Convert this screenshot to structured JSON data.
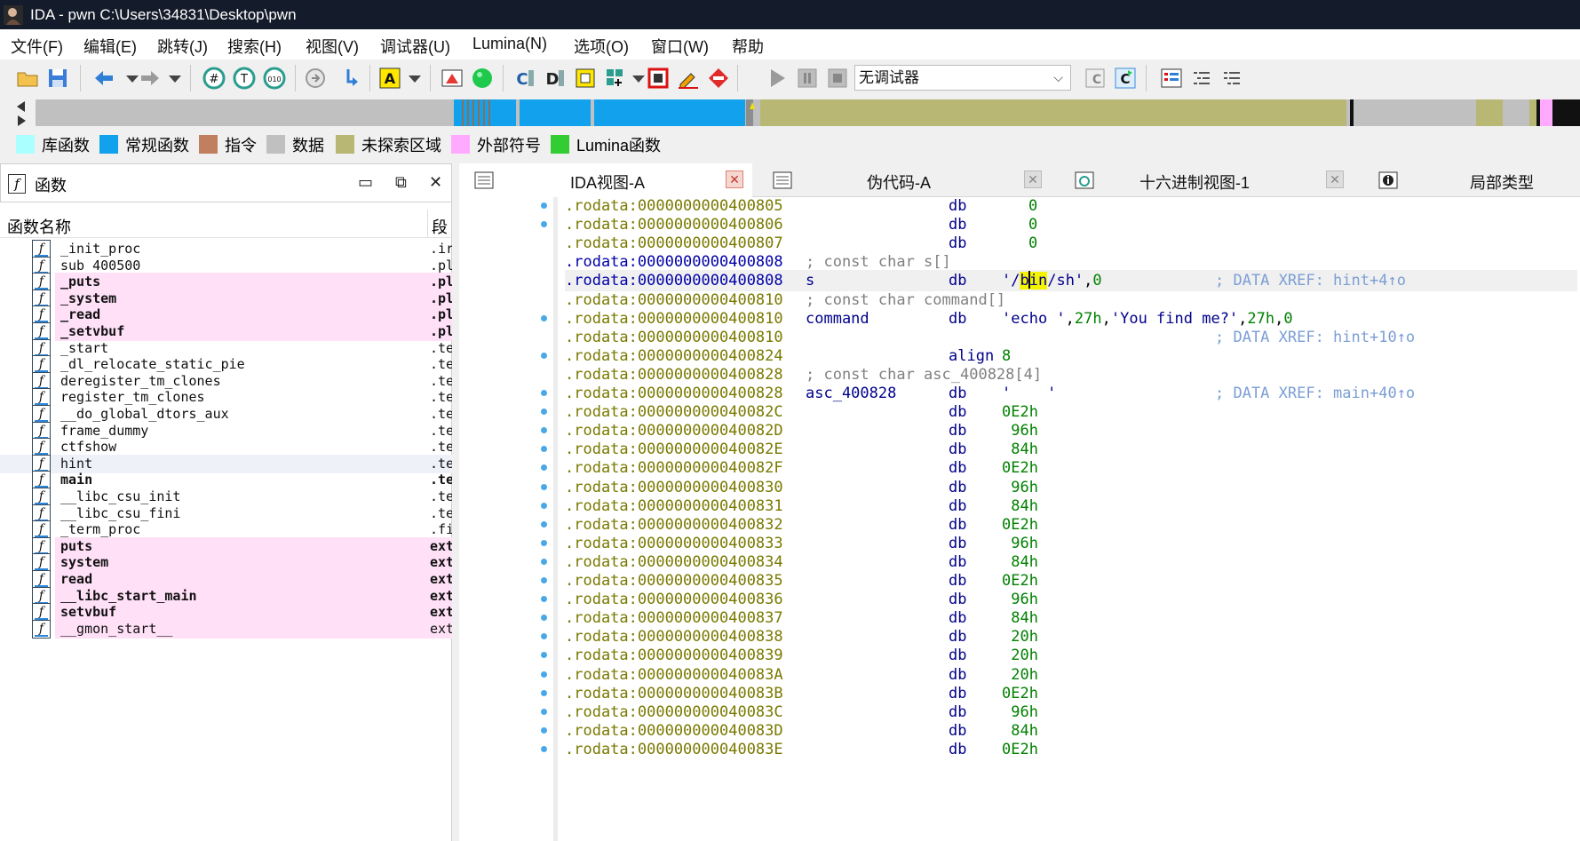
{
  "window": {
    "title": "IDA - pwn C:\\Users\\34831\\Desktop\\pwn"
  },
  "menu": [
    "文件(F)",
    "编辑(E)",
    "跳转(J)",
    "搜索(H)",
    "视图(V)",
    "调试器(U)",
    "Lumina(N)",
    "选项(O)",
    "窗口(W)",
    "帮助"
  ],
  "toolbar": {
    "debugger_select": "无调试器"
  },
  "legend": [
    {
      "label": "库函数",
      "color": "#aaffff"
    },
    {
      "label": "常规函数",
      "color": "#12a2ed"
    },
    {
      "label": "指令",
      "color": "#c08060"
    },
    {
      "label": "数据",
      "color": "#c0c0c0"
    },
    {
      "label": "未探索区域",
      "color": "#b9b774"
    },
    {
      "label": "外部符号",
      "color": "#ffaaff"
    },
    {
      "label": "Lumina函数",
      "color": "#33cc33"
    }
  ],
  "functions_panel": {
    "title": "函数",
    "col_name": "函数名称",
    "col_segment": "段",
    "items": [
      {
        "name": "_init_proc",
        "segment": ".ir",
        "style": "normal"
      },
      {
        "name": "sub_400500",
        "segment": ".pl",
        "style": "normal"
      },
      {
        "name": "_puts",
        "segment": ".pl",
        "style": "pink"
      },
      {
        "name": "_system",
        "segment": ".pl",
        "style": "pink"
      },
      {
        "name": "_read",
        "segment": ".pl",
        "style": "pink"
      },
      {
        "name": "_setvbuf",
        "segment": ".pl",
        "style": "pink"
      },
      {
        "name": "_start",
        "segment": ".te",
        "style": "normal"
      },
      {
        "name": "_dl_relocate_static_pie",
        "segment": ".te",
        "style": "normal"
      },
      {
        "name": "deregister_tm_clones",
        "segment": ".te",
        "style": "normal"
      },
      {
        "name": "register_tm_clones",
        "segment": ".te",
        "style": "normal"
      },
      {
        "name": "__do_global_dtors_aux",
        "segment": ".te",
        "style": "normal"
      },
      {
        "name": "frame_dummy",
        "segment": ".te",
        "style": "normal"
      },
      {
        "name": "ctfshow",
        "segment": ".te",
        "style": "normal"
      },
      {
        "name": "hint",
        "segment": ".te",
        "style": "selected"
      },
      {
        "name": "main",
        "segment": ".te",
        "style": "bold"
      },
      {
        "name": "__libc_csu_init",
        "segment": ".te",
        "style": "normal"
      },
      {
        "name": "__libc_csu_fini",
        "segment": ".te",
        "style": "normal"
      },
      {
        "name": "_term_proc",
        "segment": ".fi",
        "style": "normal"
      },
      {
        "name": "puts",
        "segment": "ext",
        "style": "pink-extern"
      },
      {
        "name": "system",
        "segment": "ext",
        "style": "pink-extern"
      },
      {
        "name": "read",
        "segment": "ext",
        "style": "pink-extern"
      },
      {
        "name": "__libc_start_main",
        "segment": "ext",
        "style": "pink-extern"
      },
      {
        "name": "setvbuf",
        "segment": "ext",
        "style": "pink-extern"
      },
      {
        "name": "__gmon_start__",
        "segment": "ext",
        "style": "pink-plain"
      }
    ]
  },
  "tabs": [
    {
      "label": "IDA视图-A",
      "active": true
    },
    {
      "label": "伪代码-A",
      "active": false
    },
    {
      "label": "十六进制视图-1",
      "active": false
    },
    {
      "label": "局部类型",
      "active": false
    }
  ],
  "disasm": [
    {
      "addr": ".rodata:0000000000400805",
      "ins": "db",
      "ops": "0",
      "dot": true
    },
    {
      "addr": ".rodata:0000000000400806",
      "ins": "db",
      "ops": "0",
      "dot": true
    },
    {
      "addr": ".rodata:0000000000400807",
      "ins": "db",
      "ops": "0",
      "dot": false
    },
    {
      "addr": ".rodata:0000000000400808",
      "addr_blue": true,
      "comment": "; const char s[]",
      "dot": false
    },
    {
      "addr": ".rodata:0000000000400808",
      "addr_blue": true,
      "label": "s",
      "ins": "db",
      "ops_special": "binsh",
      "xref": "; DATA XREF: hint+4↑o",
      "highlight": true,
      "dot": false
    },
    {
      "addr": ".rodata:0000000000400810",
      "comment": "; const char command[]",
      "dot": false
    },
    {
      "addr": ".rodata:0000000000400810",
      "label": "command",
      "ins": "db",
      "ops_special": "echo",
      "dot": true
    },
    {
      "addr": ".rodata:0000000000400810",
      "xref": "; DATA XREF: hint+10↑o",
      "dot": false
    },
    {
      "addr": ".rodata:0000000000400824",
      "ins": "align",
      "ops": "8",
      "dot": true
    },
    {
      "addr": ".rodata:0000000000400828",
      "comment": "; const char asc_400828[4]",
      "dot": false
    },
    {
      "addr": ".rodata:0000000000400828",
      "label": "asc_400828",
      "ins": "db",
      "ops_special": "asc",
      "xref": "; DATA XREF: main+40↑o",
      "dot": true
    },
    {
      "addr": ".rodata:000000000040082C",
      "ins": "db",
      "ops": "0E2h",
      "dot": true
    },
    {
      "addr": ".rodata:000000000040082D",
      "ins": "db",
      "ops": " 96h",
      "dot": true
    },
    {
      "addr": ".rodata:000000000040082E",
      "ins": "db",
      "ops": " 84h",
      "dot": true
    },
    {
      "addr": ".rodata:000000000040082F",
      "ins": "db",
      "ops": "0E2h",
      "dot": true
    },
    {
      "addr": ".rodata:0000000000400830",
      "ins": "db",
      "ops": " 96h",
      "dot": true
    },
    {
      "addr": ".rodata:0000000000400831",
      "ins": "db",
      "ops": " 84h",
      "dot": true
    },
    {
      "addr": ".rodata:0000000000400832",
      "ins": "db",
      "ops": "0E2h",
      "dot": true
    },
    {
      "addr": ".rodata:0000000000400833",
      "ins": "db",
      "ops": " 96h",
      "dot": true
    },
    {
      "addr": ".rodata:0000000000400834",
      "ins": "db",
      "ops": " 84h",
      "dot": true
    },
    {
      "addr": ".rodata:0000000000400835",
      "ins": "db",
      "ops": "0E2h",
      "dot": true
    },
    {
      "addr": ".rodata:0000000000400836",
      "ins": "db",
      "ops": " 96h",
      "dot": true
    },
    {
      "addr": ".rodata:0000000000400837",
      "ins": "db",
      "ops": " 84h",
      "dot": true
    },
    {
      "addr": ".rodata:0000000000400838",
      "ins": "db",
      "ops": " 20h",
      "dot": true
    },
    {
      "addr": ".rodata:0000000000400839",
      "ins": "db",
      "ops": " 20h",
      "dot": true
    },
    {
      "addr": ".rodata:000000000040083A",
      "ins": "db",
      "ops": " 20h",
      "dot": true
    },
    {
      "addr": ".rodata:000000000040083B",
      "ins": "db",
      "ops": "0E2h",
      "dot": true
    },
    {
      "addr": ".rodata:000000000040083C",
      "ins": "db",
      "ops": " 96h",
      "dot": true
    },
    {
      "addr": ".rodata:000000000040083D",
      "ins": "db",
      "ops": " 84h",
      "dot": true
    },
    {
      "addr": ".rodata:000000000040083E",
      "ins": "db",
      "ops": "0E2h",
      "dot": true
    }
  ],
  "colors": {
    "accent": "#12a2ed",
    "address": "#797900",
    "xref": "#7c9ed4",
    "extern_pink": "#ffe0f7"
  }
}
